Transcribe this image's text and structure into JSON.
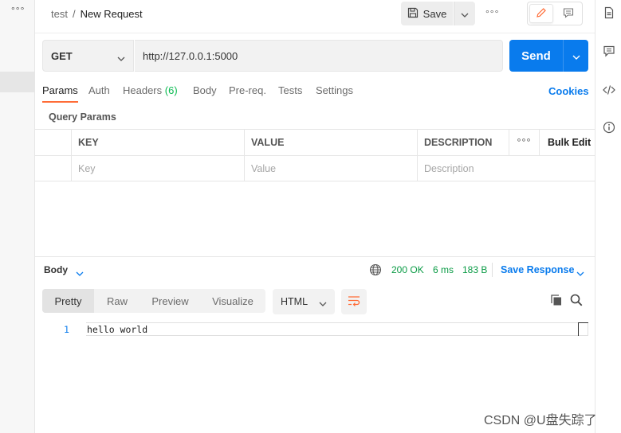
{
  "header": {
    "breadcrumb_parent": "test",
    "breadcrumb_separator": "/",
    "request_name": "New Request",
    "save_label": "Save",
    "more_label": "°°°"
  },
  "left_sidebar": {
    "more_label": "°°°"
  },
  "request": {
    "method": "GET",
    "url": "http://127.0.0.1:5000",
    "send_label": "Send"
  },
  "request_tabs": [
    {
      "label": "Params",
      "count": "",
      "active": true
    },
    {
      "label": "Auth",
      "count": "",
      "active": false
    },
    {
      "label": "Headers",
      "count": "(6)",
      "active": false
    },
    {
      "label": "Body",
      "count": "",
      "active": false
    },
    {
      "label": "Pre-req.",
      "count": "",
      "active": false
    },
    {
      "label": "Tests",
      "count": "",
      "active": false
    },
    {
      "label": "Settings",
      "count": "",
      "active": false
    }
  ],
  "cookies_label": "Cookies",
  "query_params": {
    "title": "Query Params",
    "columns": [
      "KEY",
      "VALUE",
      "DESCRIPTION"
    ],
    "more_label": "°°°",
    "bulk_edit_label": "Bulk Edit",
    "placeholders": {
      "key": "Key",
      "value": "Value",
      "description": "Description"
    }
  },
  "response": {
    "body_label": "Body",
    "status": "200 OK",
    "time": "6 ms",
    "size": "183 B",
    "save_response_label": "Save Response",
    "view_tabs": [
      {
        "label": "Pretty",
        "active": true
      },
      {
        "label": "Raw",
        "active": false
      },
      {
        "label": "Preview",
        "active": false
      },
      {
        "label": "Visualize",
        "active": false
      }
    ],
    "format": "HTML",
    "lines": [
      {
        "number": "1",
        "text": "hello world"
      }
    ]
  },
  "watermark": "CSDN @U盘失踪了",
  "colors": {
    "accent_blue": "#097bed",
    "tab_underline": "#ff6c37",
    "status_green": "#0a9b45",
    "count_green": "#0cbb52"
  },
  "icons": [
    "save-icon",
    "chevron-down-icon",
    "pencil-icon",
    "comment-icon",
    "globe-icon",
    "wrap-lines-icon",
    "copy-icon",
    "search-icon",
    "document-icon",
    "code-icon",
    "info-icon"
  ]
}
